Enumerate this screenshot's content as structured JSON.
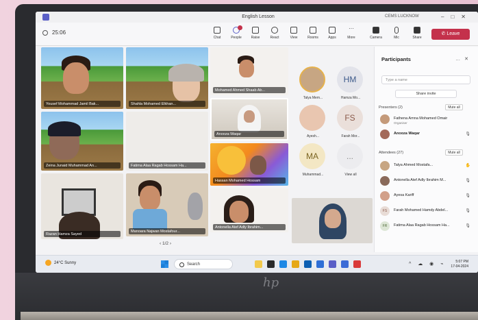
{
  "meeting": {
    "window_title": "English Lesson",
    "org": "CEMS LUCKNOW",
    "timer": "25:06",
    "toolbar": [
      "Chat",
      "People",
      "Raise",
      "React",
      "View",
      "Rooms",
      "Apps",
      "More",
      "Camera",
      "Mic",
      "Share"
    ],
    "people_count": "26",
    "leave_label": "Leave"
  },
  "tiles": [
    {
      "name": "Yousef Mohammad Jamil Bak..."
    },
    {
      "name": "Shahla Mohamed Elkhan..."
    },
    {
      "name": "Mohamed Ahmed Shaab Ab..."
    },
    {
      "name": "Zeina Junaid Muhammad An..."
    },
    {
      "name": "Fatima Alaa Ragab Hossam Ha..."
    },
    {
      "name": "Anooza Waqar"
    },
    {
      "name": "Razan Hamza Sayed"
    },
    {
      "name": "Manoara Najwan Mostafour..."
    },
    {
      "name": "Hassan Mohamed Hossam"
    },
    {
      "name": "Antonella Atef Adly Ibrahim..."
    }
  ],
  "pager": "1/2",
  "avatars": [
    {
      "initials": "",
      "name": "Talya Mem..."
    },
    {
      "initials": "HM",
      "name": "Hamza Mo..."
    },
    {
      "initials": "",
      "name": "Ayesh..."
    },
    {
      "initials": "FS",
      "name": "Farah Mor..."
    },
    {
      "initials": "MA",
      "name": "Muhammad..."
    },
    {
      "initials": "...",
      "name": "View all"
    }
  ],
  "panel": {
    "title": "Participants",
    "search_placeholder": "Type a name",
    "share_invite": "Share invite",
    "presenters_label": "Presenters (2)",
    "attendees_label": "Attendees (27)",
    "mute_all": "Mute all",
    "presenters": [
      {
        "name": "Fathena Amna Mohamed Omair",
        "role": "Organiser"
      },
      {
        "name": "Anooza Waqar",
        "role": ""
      }
    ],
    "attendees": [
      {
        "initials": "",
        "name": "Talya Ahmed Mostafa..."
      },
      {
        "initials": "",
        "name": "Antonella Atef Adly Ibrahim M..."
      },
      {
        "initials": "",
        "name": "Ayesa Kariff"
      },
      {
        "initials": "FS",
        "name": "Farah Mohamed Hamdy Abdel..."
      },
      {
        "initials": "FR",
        "name": "Fatima Alaa Ragab Hossam Ha..."
      }
    ]
  },
  "taskbar": {
    "temp": "24°C",
    "weather": "Sunny",
    "search": "Search",
    "time": "5:07 PM",
    "date": "17-04-2024"
  }
}
